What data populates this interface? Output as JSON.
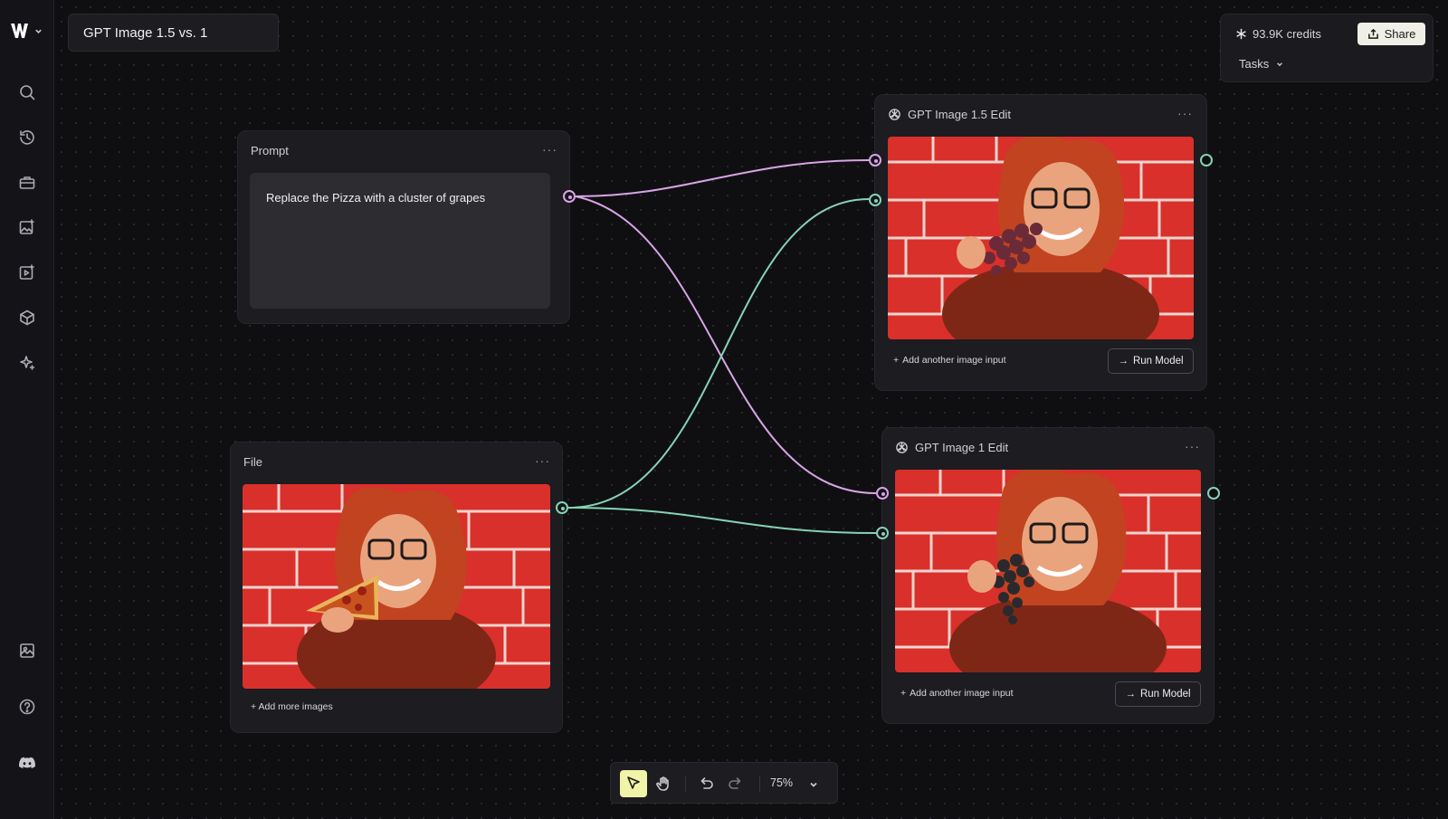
{
  "app": {
    "title": "GPT Image 1.5 vs. 1",
    "credits": "93.9K credits",
    "share_label": "Share",
    "tasks_label": "Tasks"
  },
  "sidebar": {
    "icons": [
      "search-icon",
      "history-icon",
      "briefcase-icon",
      "image-edit-icon",
      "video-icon",
      "cube-icon",
      "sparkle-icon",
      "gallery-icon",
      "help-icon",
      "discord-icon"
    ]
  },
  "nodes": {
    "prompt": {
      "title": "Prompt",
      "menu": "···",
      "text": "Replace the Pizza with a cluster of grapes"
    },
    "file": {
      "title": "File",
      "menu": "···",
      "add_label": "+ Add more images"
    },
    "edit15": {
      "title": "GPT Image 1.5 Edit",
      "menu": "···",
      "add_label": "Add another image input",
      "run_label": "Run Model"
    },
    "edit1": {
      "title": "GPT Image 1 Edit",
      "menu": "···",
      "add_label": "Add another image input",
      "run_label": "Run Model"
    }
  },
  "colors": {
    "prompt_wire": "#d9a4e6",
    "image_wire": "#86d3b3",
    "brick": "#d9302b",
    "hair": "#c2431f",
    "sweater": "#8a2a18"
  },
  "toolbar": {
    "zoom": "75%",
    "tools": [
      "select-tool",
      "hand-tool",
      "undo",
      "redo"
    ]
  }
}
